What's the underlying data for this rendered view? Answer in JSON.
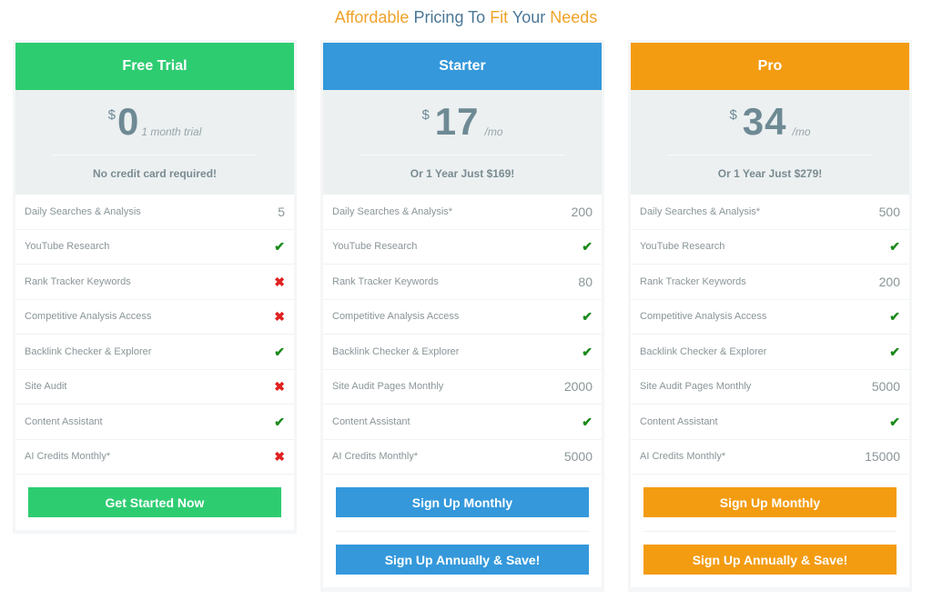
{
  "page": {
    "title_words": [
      {
        "text": "Affordable",
        "tone": "orange"
      },
      {
        "text": "Pricing",
        "tone": "blue"
      },
      {
        "text": "To",
        "tone": "blue"
      },
      {
        "text": "Fit",
        "tone": "orange"
      },
      {
        "text": "Your",
        "tone": "blue"
      },
      {
        "text": "Needs",
        "tone": "orange"
      }
    ]
  },
  "colors": {
    "free": "#2ecc71",
    "starter": "#3498db",
    "pro": "#f39c12",
    "check": "#1a8a1a",
    "cross": "#e02020",
    "title_orange": "#f0a22a",
    "title_blue": "#4a7797"
  },
  "plans": [
    {
      "id": "free",
      "name": "Free Trial",
      "currency": "$",
      "amount": "0",
      "period": "1 month trial",
      "note": "No credit card required!",
      "features": [
        {
          "label": "Daily Searches & Analysis",
          "value": "5",
          "type": "text"
        },
        {
          "label": "YouTube Research",
          "value": "check-icon",
          "type": "check"
        },
        {
          "label": "Rank Tracker Keywords",
          "value": "cross-icon",
          "type": "cross"
        },
        {
          "label": "Competitive Analysis Access",
          "value": "cross-icon",
          "type": "cross"
        },
        {
          "label": "Backlink Checker & Explorer",
          "value": "check-icon",
          "type": "check"
        },
        {
          "label": "Site Audit",
          "value": "cross-icon",
          "type": "cross"
        },
        {
          "label": "Content Assistant",
          "value": "check-icon",
          "type": "check"
        },
        {
          "label": "AI Credits Monthly*",
          "value": "cross-icon",
          "type": "cross"
        }
      ],
      "buttons": [
        "Get Started Now"
      ]
    },
    {
      "id": "starter",
      "name": "Starter",
      "currency": "$",
      "amount": "17",
      "period": "/mo",
      "note": "Or 1 Year Just $169!",
      "features": [
        {
          "label": "Daily Searches & Analysis*",
          "value": "200",
          "type": "text"
        },
        {
          "label": "YouTube Research",
          "value": "check-icon",
          "type": "check"
        },
        {
          "label": "Rank Tracker Keywords",
          "value": "80",
          "type": "text"
        },
        {
          "label": "Competitive Analysis Access",
          "value": "check-icon",
          "type": "check"
        },
        {
          "label": "Backlink Checker & Explorer",
          "value": "check-icon",
          "type": "check"
        },
        {
          "label": "Site Audit Pages Monthly",
          "value": "2000",
          "type": "text"
        },
        {
          "label": "Content Assistant",
          "value": "check-icon",
          "type": "check"
        },
        {
          "label": "AI Credits Monthly*",
          "value": "5000",
          "type": "text"
        }
      ],
      "buttons": [
        "Sign Up Monthly",
        "Sign Up Annually & Save!"
      ]
    },
    {
      "id": "pro",
      "name": "Pro",
      "currency": "$",
      "amount": "34",
      "period": "/mo",
      "note": "Or 1 Year Just $279!",
      "features": [
        {
          "label": "Daily Searches & Analysis*",
          "value": "500",
          "type": "text"
        },
        {
          "label": "YouTube Research",
          "value": "check-icon",
          "type": "check"
        },
        {
          "label": "Rank Tracker Keywords",
          "value": "200",
          "type": "text"
        },
        {
          "label": "Competitive Analysis Access",
          "value": "check-icon",
          "type": "check"
        },
        {
          "label": "Backlink Checker & Explorer",
          "value": "check-icon",
          "type": "check"
        },
        {
          "label": "Site Audit Pages Monthly",
          "value": "5000",
          "type": "text"
        },
        {
          "label": "Content Assistant",
          "value": "check-icon",
          "type": "check"
        },
        {
          "label": "AI Credits Monthly*",
          "value": "15000",
          "type": "text"
        }
      ],
      "buttons": [
        "Sign Up Monthly",
        "Sign Up Annually & Save!"
      ]
    }
  ]
}
